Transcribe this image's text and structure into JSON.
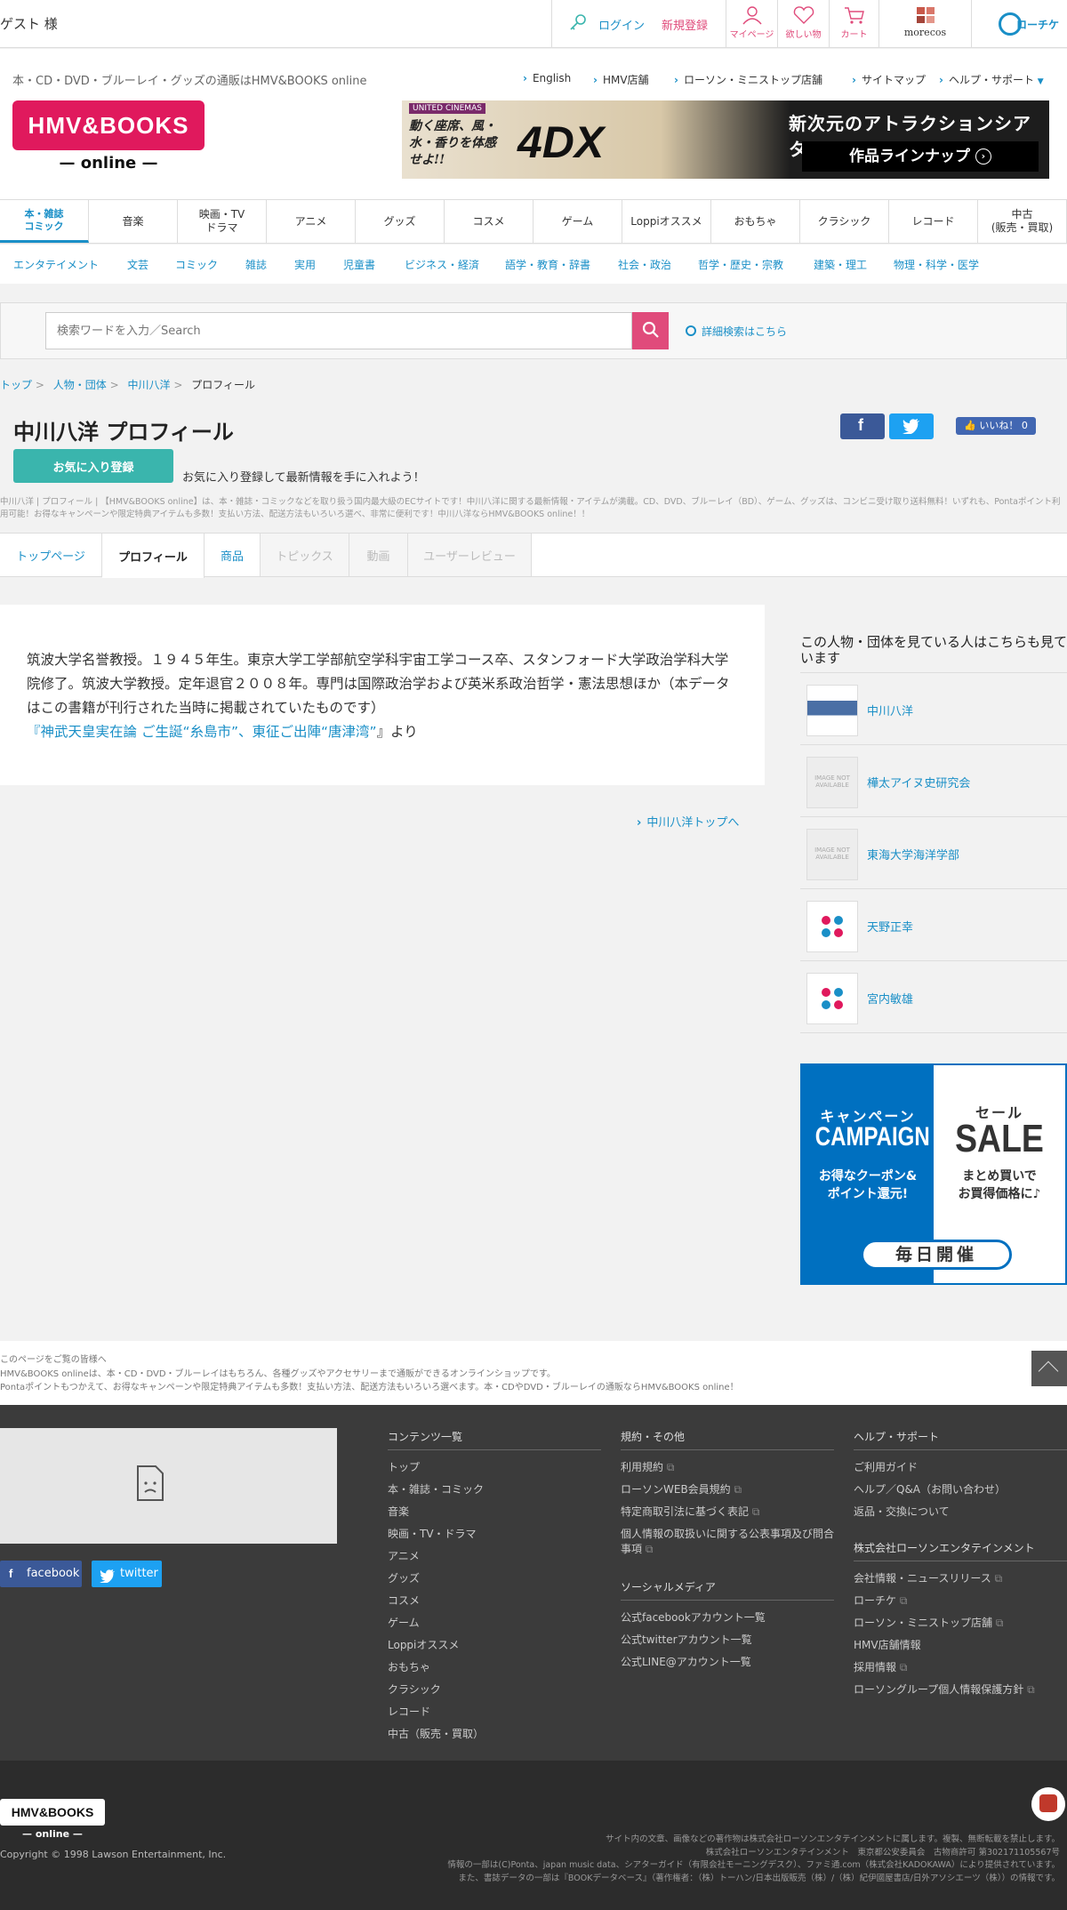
{
  "topbar": {
    "guest": "ゲスト 様",
    "login": "ログイン",
    "signup": "新規登録",
    "mypage": "マイページ",
    "wishlist": "欲しい物",
    "cart": "カート",
    "morecos": "morecos",
    "lochike": "ローチケ"
  },
  "header": {
    "tagline": "本・CD・DVD・ブルーレイ・グッズの通販はHMV&BOOKS online",
    "links": [
      "English",
      "HMV店舗",
      "ローソン・ミニストップ店舗",
      "サイトマップ",
      "ヘルプ・サポート"
    ],
    "logo_main": "HMV&BOOKS",
    "logo_sub": "— online —",
    "banner": {
      "brand": "UNITED CINEMAS",
      "left_copy": "動く座席、風・水・香りを体感せよ!!",
      "product": "4DX",
      "headline": "新次元のアトラクションシアター",
      "button": "作品ラインナップ"
    }
  },
  "categories": [
    "本・雑誌\nコミック",
    "音楽",
    "映画・TV\nドラマ",
    "アニメ",
    "グッズ",
    "コスメ",
    "ゲーム",
    "Loppiオススメ",
    "おもちゃ",
    "クラシック",
    "レコード",
    "中古\n(販売・買取)"
  ],
  "subcategories": [
    "エンタテイメント",
    "文芸",
    "コミック",
    "雑誌",
    "実用",
    "児童書",
    "ビジネス・経済",
    "語学・教育・辞書",
    "社会・政治",
    "哲学・歴史・宗教",
    "建築・理工",
    "物理・科学・医学"
  ],
  "search": {
    "placeholder": "検索ワードを入力／Search",
    "advanced": "詳細検索はこちら"
  },
  "breadcrumb": [
    "トップ",
    "人物・団体",
    "中川八洋",
    "プロフィール"
  ],
  "page": {
    "title": "中川八洋 プロフィール",
    "fav_button": "お気に入り登録",
    "fav_text": "お気に入り登録して最新情報を手に入れよう！",
    "like": "いいね！ 0",
    "description": "中川八洋 | プロフィール | 【HMV&BOOKS online】は、本・雑誌・コミックなどを取り扱う国内最大級のECサイトです！中川八洋に関する最新情報・アイテムが満載。CD、DVD、ブルーレイ（BD）、ゲーム、グッズは、コンビニ受け取り送料無料！いずれも、Pontaポイント利用可能！お得なキャンペーンや限定特典アイテムも多数！支払い方法、配送方法もいろいろ選べ、非常に便利です！中川八洋ならHMV&BOOKS online！！"
  },
  "tabs": [
    "トップページ",
    "プロフィール",
    "商品",
    "トピックス",
    "動画",
    "ユーザーレビュー"
  ],
  "profile": {
    "text": "筑波大学名誉教授。１９４５年生。東京大学工学部航空学科宇宙工学コース卒、スタンフォード大学政治学科大学院修了。筑波大学教授。定年退官２００８年。専門は国際政治学および英米系政治哲学・憲法思想ほか（本データはこの書籍が刊行された当時に掲載されていたものです）",
    "source_open": "『",
    "source_title": "神武天皇実在論 ご生誕“糸島市”、東征ご出陣“唐津湾”",
    "source_close": "』より",
    "top_link": "中川八洋トップへ"
  },
  "sidebar": {
    "title": "この人物・団体を見ている人はこちらも見ています",
    "items": [
      "中川八洋",
      "樺太アイヌ史研究会",
      "東海大学海洋学部",
      "天野正幸",
      "宮内敏雄"
    ],
    "no_image": "IMAGE NOT AVAILABLE"
  },
  "promo": {
    "campaign_jp": "キャンペーン",
    "campaign_en": "CAMPAIGN",
    "campaign_desc": "お得なクーポン&\nポイント還元!",
    "sale_jp": "セール",
    "sale_en": "SALE",
    "sale_desc": "まとめ買いで\nお買得価格に♪",
    "daily": "毎日開催"
  },
  "prefooter": {
    "l1": "このページをご覧の皆様へ",
    "l2": "HMV&BOOKS onlineは、本・CD・DVD・ブルーレイはもちろん、各種グッズやアクセサリーまで通販ができるオンラインショップです。",
    "l3": "Pontaポイントもつかえて、お得なキャンペーンや限定特典アイテムも多数！支払い方法、配送方法もいろいろ選べます。本・CDやDVD・ブルーレイの通販ならHMV&BOOKS online！"
  },
  "footer": {
    "facebook": "facebook",
    "twitter": "twitter",
    "contents_title": "コンテンツ一覧",
    "contents": [
      "トップ",
      "本・雑誌・コミック",
      "音楽",
      "映画・TV・ドラマ",
      "アニメ",
      "グッズ",
      "コスメ",
      "ゲーム",
      "Loppiオススメ",
      "おもちゃ",
      "クラシック",
      "レコード",
      "中古（販売・買取）"
    ],
    "rules_title": "規約・その他",
    "rules": [
      "利用規約",
      "ローソンWEB会員規約",
      "特定商取引法に基づく表記",
      "個人情報の取扱いに関する公表事項及び問合事項"
    ],
    "social_title": "ソーシャルメディア",
    "social": [
      "公式facebookアカウント一覧",
      "公式twitterアカウント一覧",
      "公式LINE@アカウント一覧"
    ],
    "help_title": "ヘルプ・サポート",
    "help": [
      "ご利用ガイド",
      "ヘルプ／Q&A（お問い合わせ）",
      "返品・交換について"
    ],
    "corp_title": "株式会社ローソンエンタテインメント",
    "corp": [
      "会社情報・ニュースリリース",
      "ローチケ",
      "ローソン・ミニストップ店舗",
      "HMV店舗情報",
      "採用情報",
      "ローソングループ個人情報保護方針"
    ]
  },
  "bottom": {
    "logo_main": "HMV&BOOKS",
    "logo_sub": "— online —",
    "copyright": "Copyright © 1998 Lawson Entertainment, Inc.",
    "legal1": "サイト内の文章、画像などの著作物は株式会社ローソンエンタテインメントに属します。複製、無断転載を禁止します。",
    "legal2": "株式会社ローソンエンタテインメント　東京都公安委員会　古物商許可 第302171105567号",
    "legal3": "情報の一部は(C)Ponta、japan music data、シアターガイド（有限会社モーニングデスク）、ファミ通.com（株式会社KADOKAWA）により提供されています。",
    "legal4": "また、書誌データの一部は『BOOKデータベース』（著作権者：（株）トーハン/日本出版販売（株）/（株）紀伊國屋書店/日外アソシエーツ（株））の情報です。"
  },
  "colors": {
    "accent_blue": "#1a8fc7",
    "brand_pink": "#e0195d",
    "teal": "#3ab5ad"
  }
}
